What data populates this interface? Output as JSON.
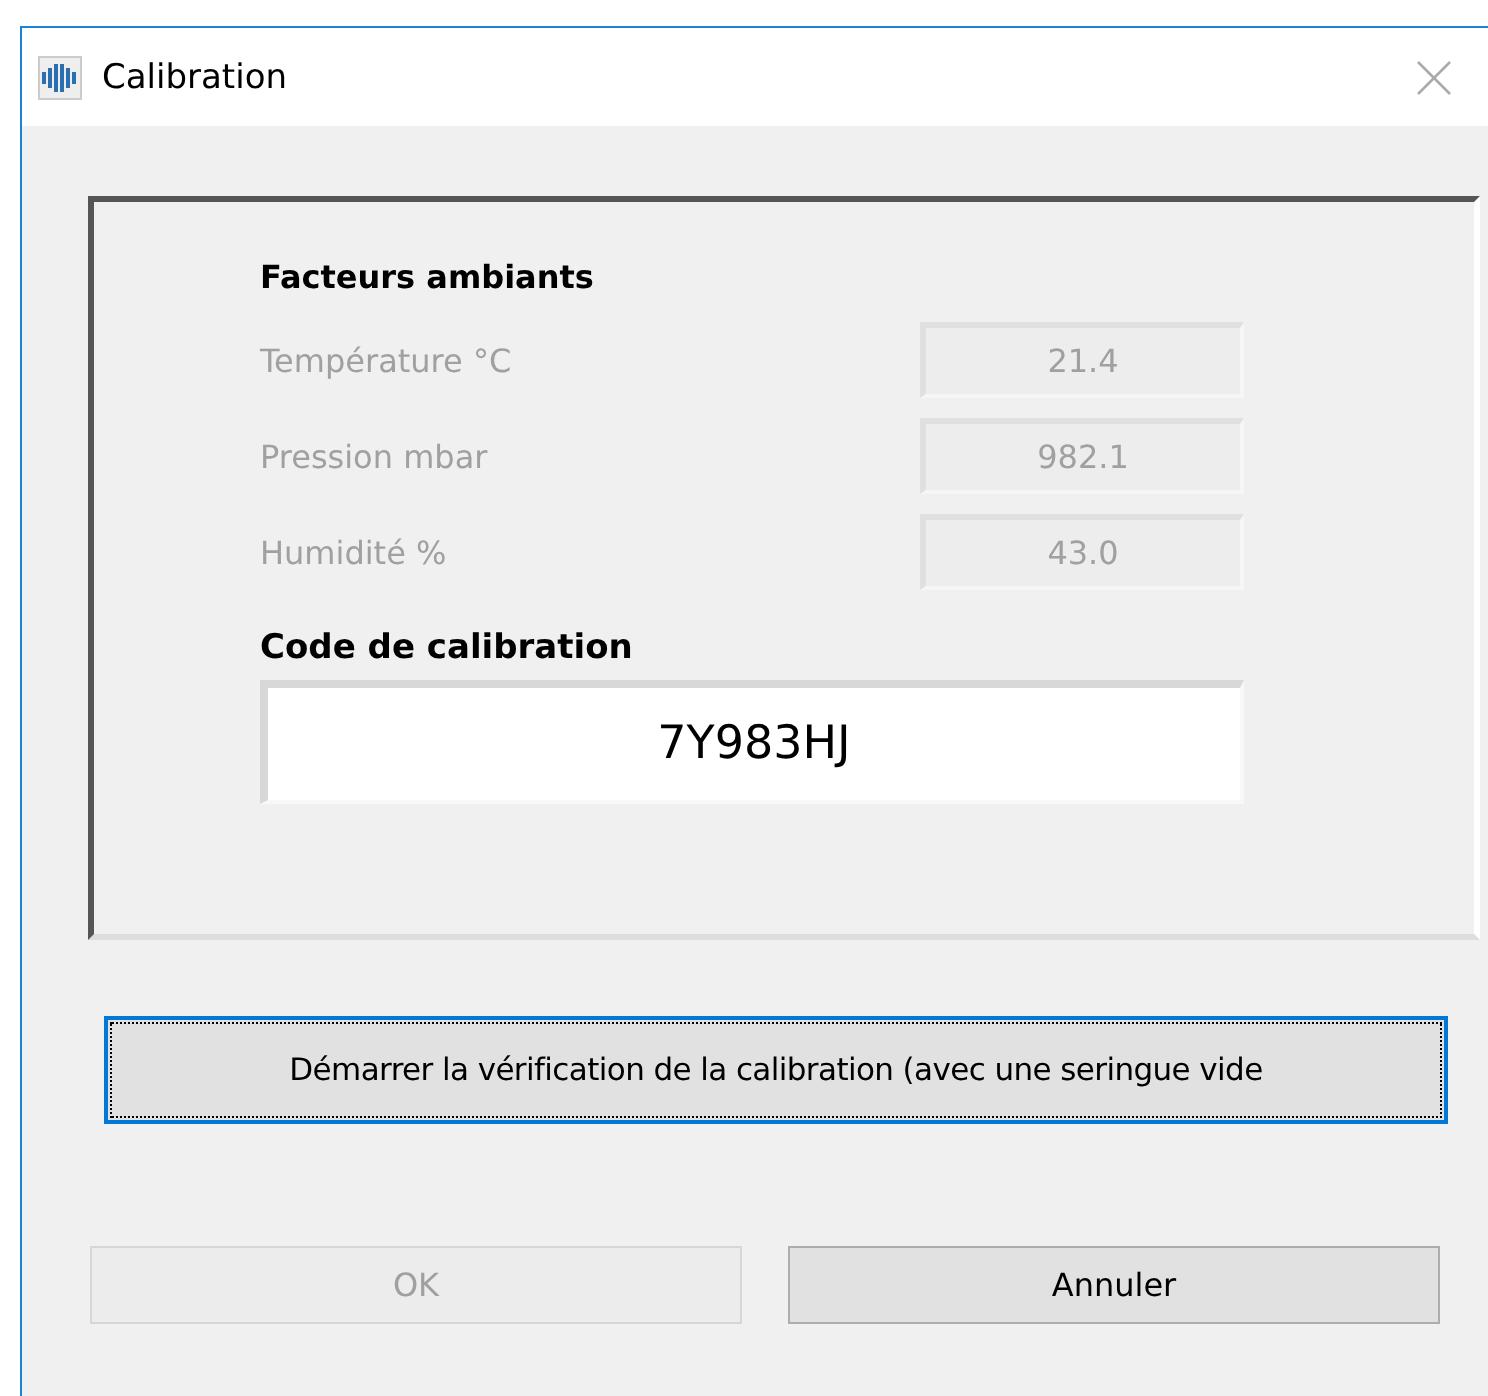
{
  "window": {
    "title": "Calibration"
  },
  "ambient": {
    "heading": "Facteurs ambiants",
    "rows": [
      {
        "label": "Température °C",
        "value": "21.4",
        "disabled": true
      },
      {
        "label": "Pression mbar",
        "value": "982.1",
        "disabled": true
      },
      {
        "label": "Humidité %",
        "value": "43.0",
        "disabled": true
      }
    ]
  },
  "calibration_code": {
    "label": "Code de calibration",
    "value": "7Y983HJ"
  },
  "verify_button": {
    "label": "Démarrer la vérification de la calibration (avec une seringue vide",
    "focused": true
  },
  "buttons": [
    {
      "label": "OK",
      "disabled": true
    },
    {
      "label": "Annuler",
      "disabled": false
    }
  ]
}
